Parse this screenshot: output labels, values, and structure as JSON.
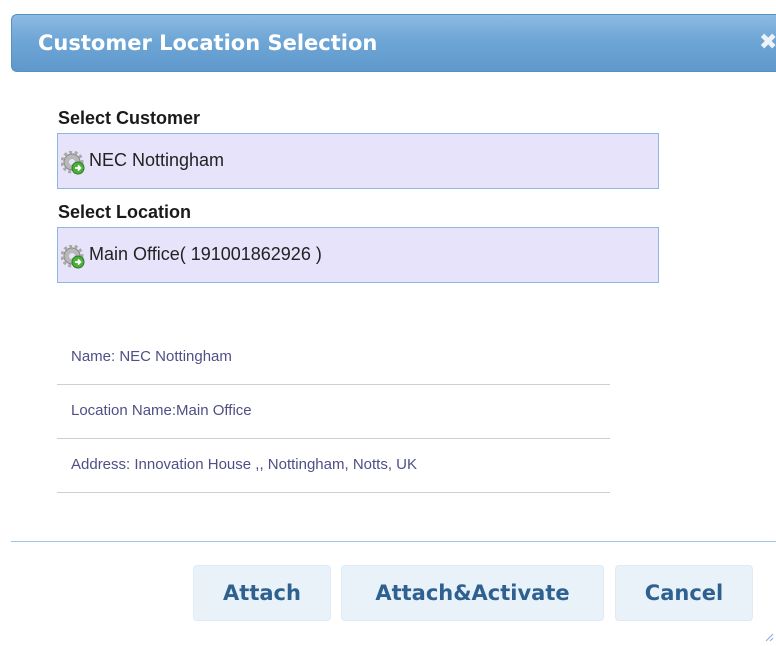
{
  "dialog": {
    "title": "Customer Location Selection",
    "close_symbol": "✖"
  },
  "customer": {
    "label": "Select Customer",
    "value": "NEC Nottingham",
    "icon": "gear-icon"
  },
  "location": {
    "label": "Select Location",
    "value": "Main Office( 191001862926 )",
    "icon": "gear-icon"
  },
  "details": {
    "name": "Name: NEC Nottingham",
    "location_name": "Location Name:Main Office",
    "address": "Address: Innovation House ,, Nottingham, Notts, UK"
  },
  "buttons": {
    "attach": "Attach",
    "attach_activate": "Attach&Activate",
    "cancel": "Cancel"
  },
  "colors": {
    "title_bar": "#6ea6d6",
    "combo_background": "#e6e3fb",
    "button_text": "#2e6190",
    "detail_text": "#4f4f86"
  }
}
